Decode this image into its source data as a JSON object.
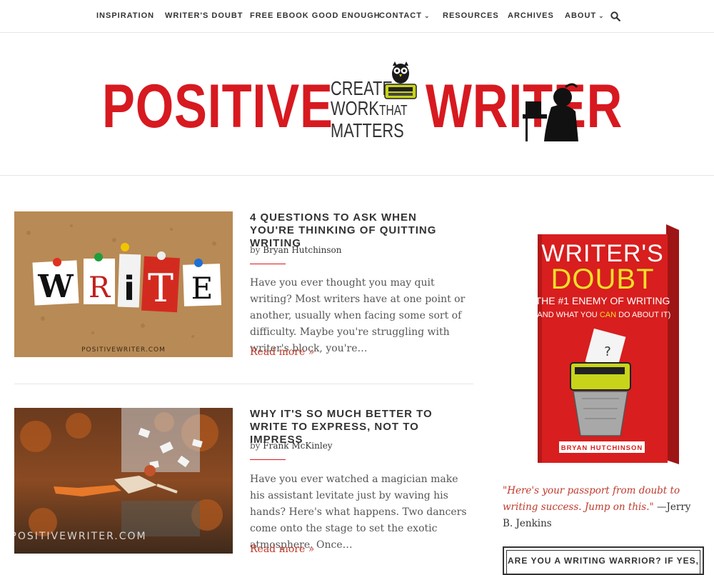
{
  "nav": {
    "items": [
      {
        "label": "INSPIRATION"
      },
      {
        "label": "WRITER'S DOUBT"
      },
      {
        "label": "FREE EBOOK GOOD ENOUGH"
      },
      {
        "label": "CONTACT"
      },
      {
        "label": "RESOURCES"
      },
      {
        "label": "ARCHIVES"
      },
      {
        "label": "ABOUT"
      }
    ]
  },
  "header": {
    "logo_left": "POSITIVE",
    "logo_right": "WRITER",
    "tagline": [
      "CREATE",
      "WORK",
      "THAT",
      "MATTERS"
    ]
  },
  "posts": [
    {
      "thumb_letters": [
        "W",
        "R",
        "i",
        "T",
        "E"
      ],
      "watermark": "POSITIVEWRITER.COM",
      "title": "4 QUESTIONS TO ASK WHEN YOU'RE THINKING OF QUITTING WRITING",
      "by": "by",
      "author": "Bryan Hutchinson",
      "excerpt": "Have you ever thought you may quit writing? Most writers have at one point or another, usually when facing some sort of difficulty. Maybe you're struggling with writer's block, you're…",
      "read_more": "Read more »"
    },
    {
      "watermark": "POSITIVEWRITER.COM",
      "title": "WHY IT'S SO MUCH BETTER TO WRITE TO EXPRESS, NOT TO IMPRESS",
      "by": "by",
      "author": "Frank McKinley",
      "excerpt": "Have you ever watched a magician make his assistant levitate just by waving his hands? Here's what happens.  Two dancers come onto the stage to set the exotic atmosphere.  Once…",
      "read_more": "Read more »"
    }
  ],
  "sidebar": {
    "book": {
      "title_line1": "WRITER'S",
      "title_line2": "DOUBT",
      "subtitle_line1": "THE #1 ENEMY OF WRITING",
      "subtitle_pre": "(AND WHAT YOU ",
      "subtitle_can": "CAN",
      "subtitle_post": " DO ABOUT IT)",
      "author": "BRYAN HUTCHINSON"
    },
    "quote_text": "\"Here's your passport from doubt to writing success. Jump on this.\"",
    "quote_author": " —Jerry B. Jenkins",
    "warrior_heading": "ARE YOU A WRITING WARRIOR? IF YES,"
  },
  "colors": {
    "brand_red": "#d71920",
    "link_red": "#c0392b"
  }
}
